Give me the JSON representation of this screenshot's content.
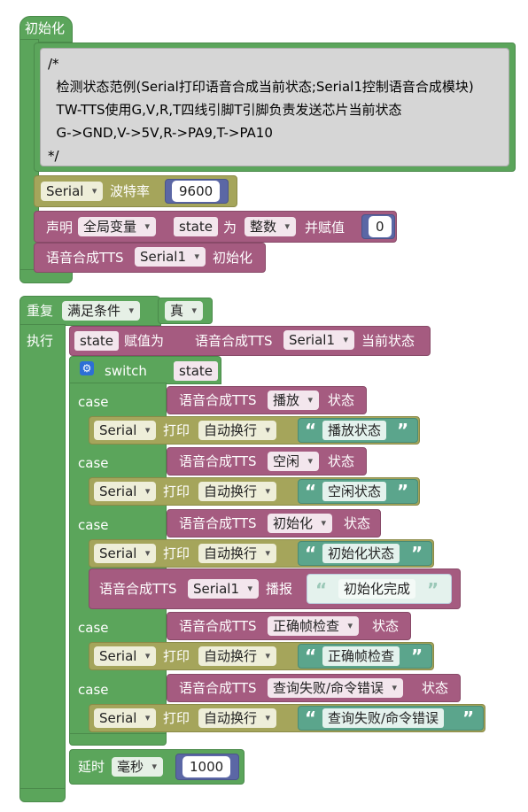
{
  "init_block": {
    "title": "初始化",
    "comment_lines": [
      "/*",
      "  检测状态范例(Serial打印语音合成当前状态;Serial1控制语音合成模块)",
      "  TW-TTS使用G,V,R,T四线引脚T引脚负责发送芯片当前状态",
      "  G->GND,V->5V,R->PA9,T->PA10",
      "*/"
    ],
    "serial_label": "Serial",
    "baud_label": "波特率",
    "baud_value": "9600",
    "declare_label": "声明",
    "declare_scope": "全局变量",
    "var_name": "state",
    "as_label": "为",
    "var_type": "整数",
    "assign_label": "并赋值",
    "init_value": "0",
    "tts_init_prefix": "语音合成TTS",
    "tts_init_port": "Serial1",
    "tts_init_suffix": "初始化"
  },
  "loop_block": {
    "repeat_label": "重复",
    "repeat_mode": "满足条件",
    "condition": "真",
    "do_label": "执行",
    "assign_var": "state",
    "assign_label": "赋值为",
    "tts_status_prefix": "语音合成TTS",
    "tts_status_port": "Serial1",
    "tts_status_suffix": "当前状态",
    "switch_label": "switch",
    "switch_var": "state",
    "case_label": "case",
    "tts_prefix": "语音合成TTS",
    "status_suffix": "状态",
    "print_serial": "Serial",
    "print_label": "打印",
    "print_mode": "自动换行",
    "cases": [
      {
        "state": "播放",
        "text": "播放状态"
      },
      {
        "state": "空闲",
        "text": "空闲状态"
      },
      {
        "state": "初始化",
        "text": "初始化状态"
      },
      {
        "state": "正确帧检查",
        "text": "正确帧检查"
      },
      {
        "state": "查询失败/命令错误",
        "text": "查询失败/命令错误"
      }
    ],
    "speak_prefix": "语音合成TTS",
    "speak_port": "Serial1",
    "speak_label": "播报",
    "speak_text": "初始化完成",
    "delay_label": "延时",
    "delay_unit": "毫秒",
    "delay_value": "1000"
  },
  "colors": {
    "control": "#5ba55b",
    "serial": "#a5a55b",
    "tts": "#a55b80",
    "text": "#5ba58c",
    "math": "#5b67a5",
    "comment": "#9e9e9e"
  }
}
